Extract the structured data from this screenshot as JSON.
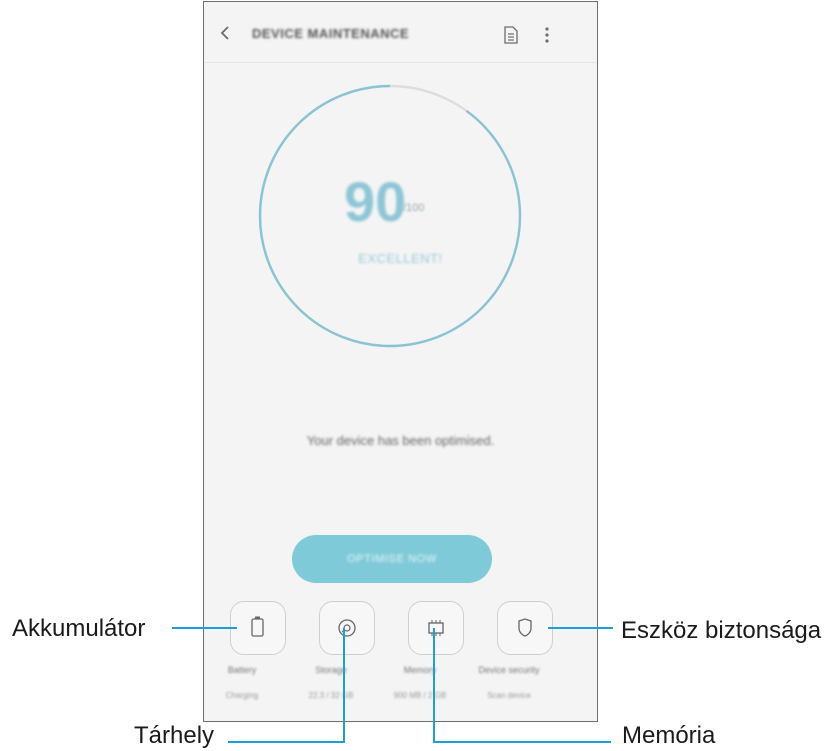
{
  "appbar": {
    "title": "DEVICE MAINTENANCE",
    "icons": [
      "back-icon",
      "report-icon",
      "more-options-icon"
    ]
  },
  "score": {
    "value": "90",
    "unit": "/100",
    "status": "EXCELLENT!",
    "ring_fraction": 0.9
  },
  "status_message": "Your device has been optimised.",
  "optimise_button": {
    "label": "OPTIMISE NOW"
  },
  "features": [
    {
      "id": "battery",
      "icon": "battery-icon",
      "label": "Battery",
      "value": "Charging"
    },
    {
      "id": "storage",
      "icon": "storage-icon",
      "label": "Storage",
      "value": "22.3 / 32 GB"
    },
    {
      "id": "memory",
      "icon": "memory-chip-icon",
      "label": "Memory",
      "value": "900 MB / 2 GB"
    },
    {
      "id": "security",
      "icon": "shield-icon",
      "label": "Device security",
      "value": "Scan device"
    }
  ],
  "callouts": {
    "battery": "Akkumulátor",
    "storage": "Tárhely",
    "memory": "Memória",
    "security": "Eszköz biztonsága"
  },
  "colors": {
    "accent": "#7fcad8",
    "ring": "#89c4d5",
    "ring_track": "#dddddd",
    "leader": "#1c9fd6",
    "frame": "#6f6f6f"
  }
}
